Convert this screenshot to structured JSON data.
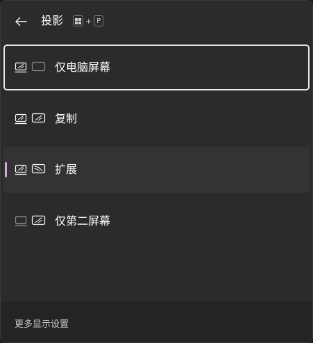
{
  "header": {
    "title": "投影",
    "back_icon": "back-arrow-icon",
    "shortcut": {
      "win_key_icon": "windows-logo-icon",
      "plus": "+",
      "key": "P"
    }
  },
  "items": [
    {
      "label": "仅电脑屏幕",
      "icon": "pc-screen-only-icon",
      "focused": true
    },
    {
      "label": "复制",
      "icon": "duplicate-icon"
    },
    {
      "label": "扩展",
      "icon": "extend-icon",
      "selected": true
    },
    {
      "label": "仅第二屏幕",
      "icon": "second-screen-only-icon"
    }
  ],
  "footer": {
    "link": "更多显示设置"
  },
  "colors": {
    "panel_bg": "#2b2b2b",
    "selected_bg": "#333333",
    "accent": "#d8a9e0",
    "focus_border": "#e8e8e8"
  }
}
